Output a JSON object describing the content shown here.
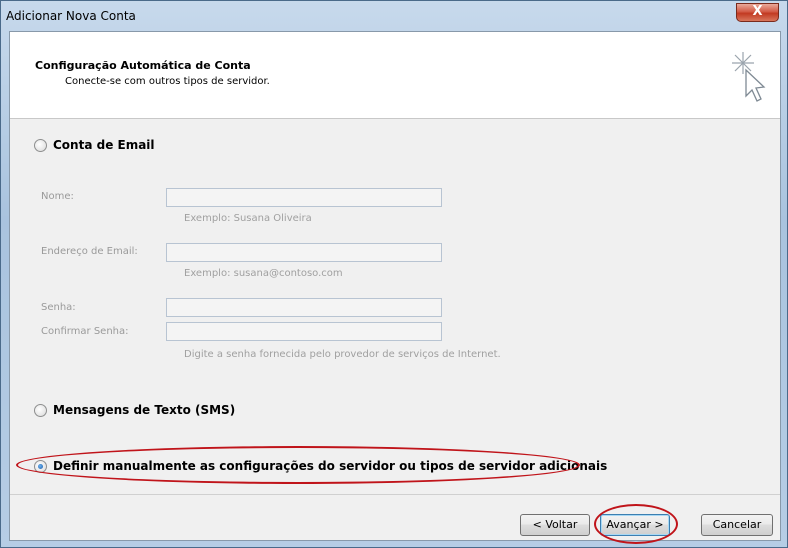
{
  "window": {
    "title": "Adicionar Nova Conta",
    "close_glyph": "X"
  },
  "header": {
    "title": "Configuração Automática de Conta",
    "subtitle": "Conecte-se com outros tipos de servidor.",
    "icon": "wizard-cursor-sparkle-icon"
  },
  "options": {
    "email": {
      "label": "Conta de Email",
      "checked": false
    },
    "sms": {
      "label": "Mensagens de Texto (SMS)",
      "checked": false
    },
    "manual": {
      "label": "Definir manualmente as configurações do servidor ou tipos de servidor adicionais",
      "checked": true
    }
  },
  "form": {
    "name_label": "Nome:",
    "name_value": "",
    "name_hint": "Exemplo: Susana Oliveira",
    "email_label": "Endereço de Email:",
    "email_value": "",
    "email_hint": "Exemplo: susana@contoso.com",
    "password_label": "Senha:",
    "password_value": "",
    "confirm_label": "Confirmar Senha:",
    "confirm_value": "",
    "password_hint": "Digite a senha fornecida pelo provedor de serviços de Internet."
  },
  "buttons": {
    "back": "< Voltar",
    "next": "Avançar >",
    "cancel": "Cancelar"
  },
  "colors": {
    "highlight_oval": "#c0141a",
    "titlebar": "#b6cde5",
    "client_bg": "#f0f0f0"
  }
}
